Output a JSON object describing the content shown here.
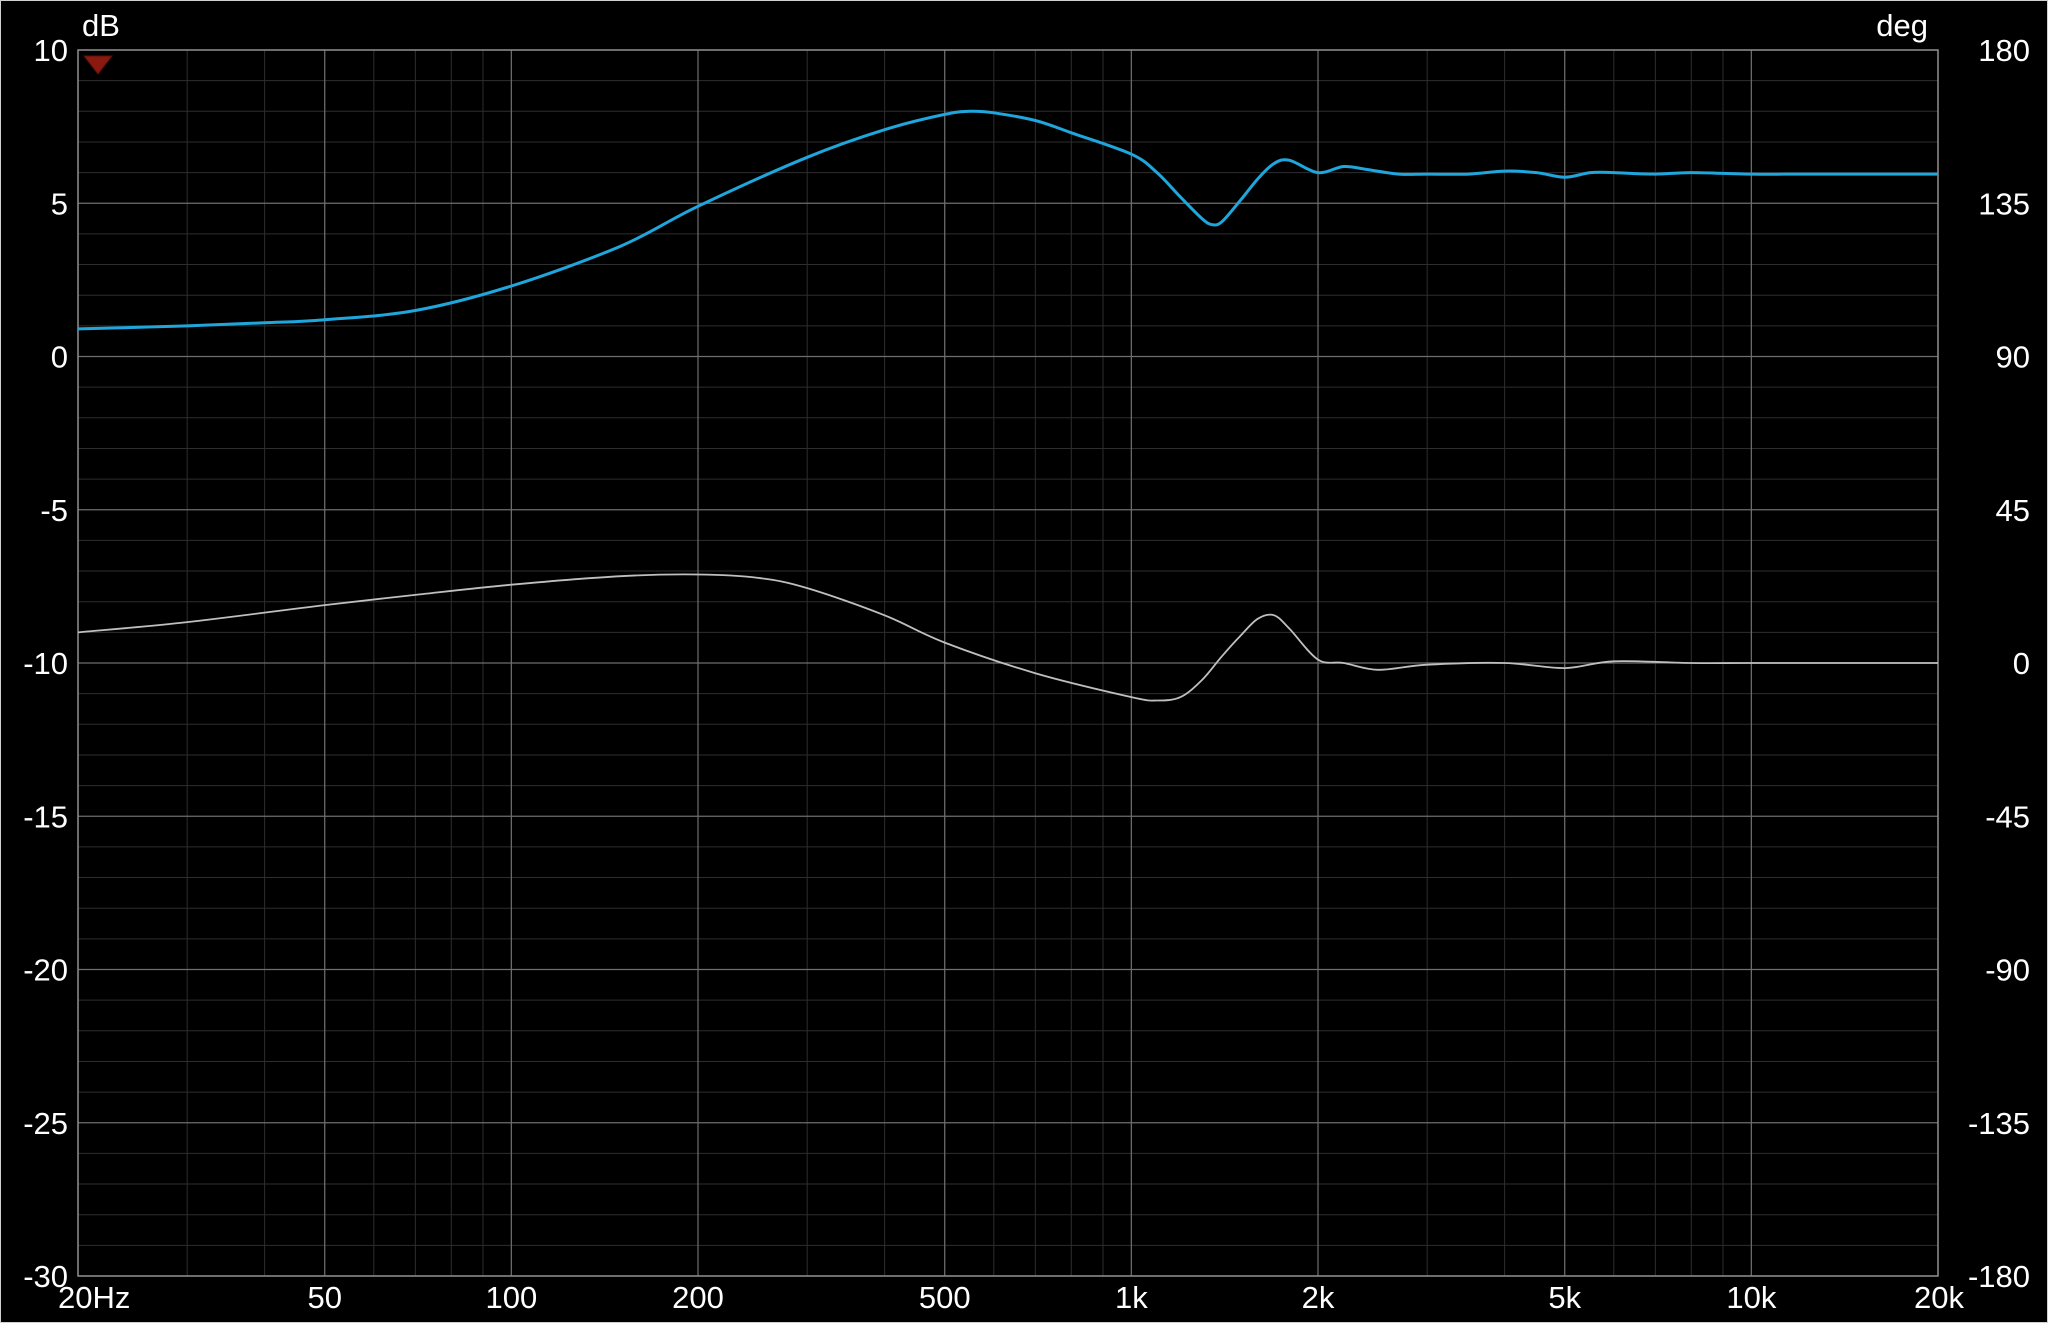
{
  "chart_data": {
    "type": "line",
    "left_unit": "dB",
    "right_unit": "deg",
    "xscale": "log",
    "xlim": [
      20,
      20000
    ],
    "ylim_left": [
      -30,
      10
    ],
    "ylim_right": [
      -180,
      180
    ],
    "grid": true,
    "background": "#000000",
    "x_ticks": [
      {
        "value": 20,
        "label": "20Hz"
      },
      {
        "value": 50,
        "label": "50"
      },
      {
        "value": 100,
        "label": "100"
      },
      {
        "value": 200,
        "label": "200"
      },
      {
        "value": 500,
        "label": "500"
      },
      {
        "value": 1000,
        "label": "1k"
      },
      {
        "value": 2000,
        "label": "2k"
      },
      {
        "value": 5000,
        "label": "5k"
      },
      {
        "value": 10000,
        "label": "10k"
      },
      {
        "value": 20000,
        "label": "20k"
      }
    ],
    "y_ticks_left": [
      {
        "value": 10,
        "label": "10"
      },
      {
        "value": 5,
        "label": "5"
      },
      {
        "value": 0,
        "label": "0"
      },
      {
        "value": -5,
        "label": "-5"
      },
      {
        "value": -10,
        "label": "-10"
      },
      {
        "value": -15,
        "label": "-15"
      },
      {
        "value": -20,
        "label": "-20"
      },
      {
        "value": -25,
        "label": "-25"
      },
      {
        "value": -30,
        "label": "-30"
      }
    ],
    "y_ticks_right": [
      {
        "value": 180,
        "label": "180"
      },
      {
        "value": 135,
        "label": "135"
      },
      {
        "value": 90,
        "label": "90"
      },
      {
        "value": 45,
        "label": "45"
      },
      {
        "value": 0,
        "label": "0"
      },
      {
        "value": -45,
        "label": "-45"
      },
      {
        "value": -90,
        "label": "-90"
      },
      {
        "value": -135,
        "label": "-135"
      },
      {
        "value": -180,
        "label": "-180"
      }
    ],
    "series": [
      {
        "axis": "left",
        "color": "#1fa6dc",
        "x": [
          20,
          30,
          40,
          50,
          70,
          100,
          150,
          200,
          300,
          400,
          500,
          550,
          600,
          700,
          800,
          1000,
          1100,
          1200,
          1300,
          1350,
          1400,
          1500,
          1600,
          1700,
          1800,
          2000,
          2200,
          2400,
          2700,
          3000,
          3500,
          4000,
          4500,
          5000,
          5500,
          6000,
          7000,
          8000,
          10000,
          12000,
          15000,
          20000
        ],
        "y": [
          0.9,
          1.0,
          1.1,
          1.2,
          1.5,
          2.3,
          3.6,
          4.9,
          6.5,
          7.4,
          7.9,
          8.0,
          7.95,
          7.7,
          7.3,
          6.6,
          6.0,
          5.2,
          4.5,
          4.3,
          4.4,
          5.1,
          5.8,
          6.3,
          6.4,
          6.0,
          6.2,
          6.1,
          5.95,
          5.95,
          5.95,
          6.05,
          6.0,
          5.85,
          6.0,
          6.0,
          5.95,
          6.0,
          5.95,
          5.95,
          5.95,
          5.95
        ]
      },
      {
        "axis": "right",
        "color": "#bfbfbf",
        "x": [
          20,
          30,
          50,
          70,
          100,
          150,
          200,
          250,
          300,
          400,
          500,
          700,
          1000,
          1100,
          1200,
          1300,
          1400,
          1500,
          1600,
          1700,
          1800,
          2000,
          2200,
          2500,
          3000,
          4000,
          5000,
          6000,
          8000,
          10000,
          15000,
          20000
        ],
        "y": [
          9,
          12,
          17,
          20,
          23,
          25.5,
          26,
          25,
          22,
          14,
          6,
          -3,
          -10,
          -11,
          -10,
          -5,
          2,
          8,
          13,
          14,
          10,
          1,
          0,
          -2,
          -0.5,
          0,
          -1.5,
          0.5,
          0,
          0,
          0,
          0
        ]
      }
    ]
  }
}
